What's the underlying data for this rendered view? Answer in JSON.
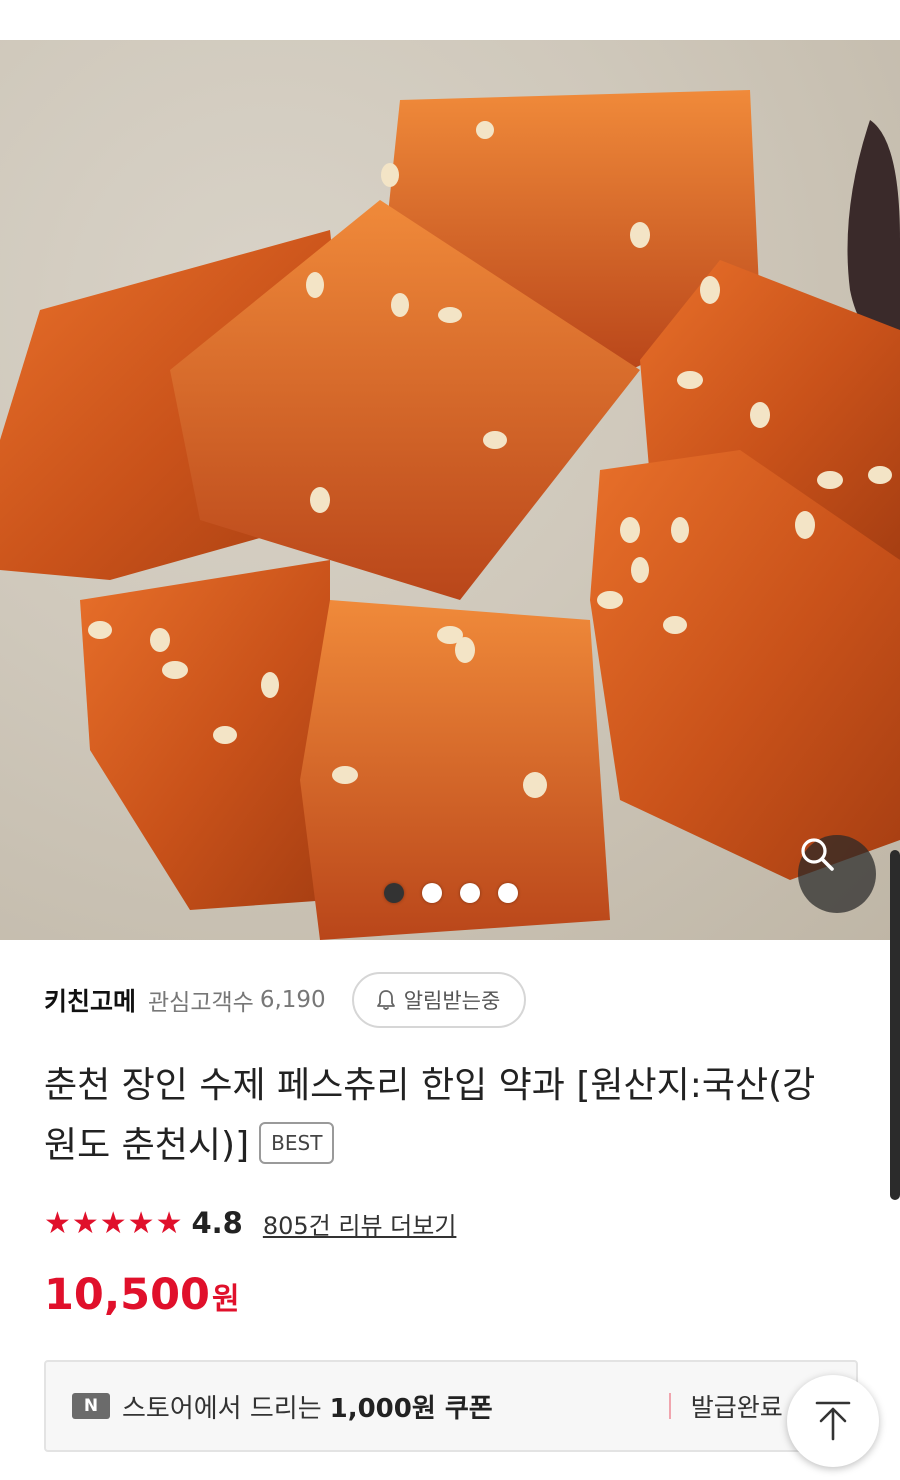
{
  "product_image": {
    "carousel_total": 4,
    "carousel_active_index": 0,
    "zoom_icon": "search-icon"
  },
  "store": {
    "name": "키친고메",
    "follower_label": "관심고객수",
    "follower_count": "6,190",
    "alert_label": "알림받는중",
    "alert_icon": "bell-icon"
  },
  "product": {
    "title": "춘천 장인 수제 페스츄리 한입 약과 [원산지:국산(강원도 춘천시)]",
    "badge": "BEST"
  },
  "rating": {
    "stars": "★★★★★",
    "value": "4.8",
    "review_link": "805건 리뷰 더보기"
  },
  "price": {
    "amount": "10,500",
    "unit": "원"
  },
  "coupon": {
    "badge": "N",
    "text": "스토어에서 드리는",
    "amount": "1,000원 쿠폰",
    "status": "발급완료"
  },
  "scroll_top": {
    "icon": "arrow-up-icon"
  },
  "colors": {
    "accent_red": "#e0102b",
    "text_dark": "#222222",
    "text_gray": "#777777"
  }
}
